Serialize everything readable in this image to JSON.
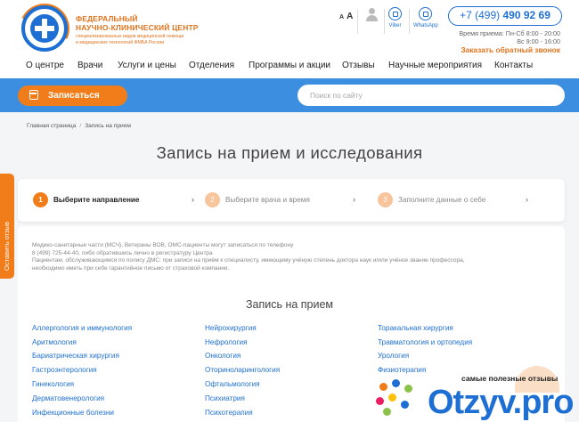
{
  "header": {
    "title_line1": "ФЕДЕРАЛЬНЫЙ",
    "title_line2": "НАУЧНО-КЛИНИЧЕСКИЙ ЦЕНТР",
    "subtitle_line1": "специализированных видов медицинской помощи",
    "subtitle_line2": "и медицинских технологий ФМБА России",
    "font_small": "A",
    "font_large": "A",
    "viber_label": "Viber",
    "whatsapp_label": "WhatsApp",
    "phone_prefix": "+7 (499) ",
    "phone_number": "490 92 69",
    "hours_line1": "Время приема: Пн-Сб 8:00 - 20:00",
    "hours_line2": "Вс 9:00 - 16:00",
    "callback_label": "Заказать обратный звонок"
  },
  "nav": {
    "items": [
      "О центре",
      "Врачи",
      "Услуги и цены",
      "Отделения",
      "Программы и акции",
      "Отзывы",
      "Научные мероприятия",
      "Контакты"
    ]
  },
  "bar": {
    "signup_label": "Записаться",
    "search_placeholder": "Поиск по сайту"
  },
  "breadcrumb": {
    "home": "Главная страница",
    "separator": "/",
    "current": "Запись на прием"
  },
  "page_title": "Запись на прием и исследования",
  "side_tab": "Оставить отзыв",
  "steps": [
    {
      "num": "1",
      "label": "Выберите направление",
      "state": "active"
    },
    {
      "num": "2",
      "label": "Выберите врача и время",
      "state": "inactive"
    },
    {
      "num": "3",
      "label": "Заполните данные о себе",
      "state": "inactive"
    }
  ],
  "step_arrow": "›",
  "notice": {
    "line1": "Медико-санитарные части (МСЧ), Ветераны ВОВ, ОМС-пациенты могут записаться по телефону",
    "line2": "8 (499) 725-44-40, либо обратившись лично в регистратуру Центра",
    "line3": "Пациентам, обслуживающимся по полису ДМС: при записи на приём к специалисту, имеющему учёную степень доктора наук и/или учёное звание профессора,",
    "line4": "необходимо иметь при себе гарантийное письмо от страховой компании."
  },
  "section_title": "Запись на прием",
  "specialties": {
    "col1": [
      "Аллергология и иммунология",
      "Аритмология",
      "Бариатрическая хирургия",
      "Гастроэнтерология",
      "Гинекология",
      "Дерматовенерология",
      "Инфекционные болезни"
    ],
    "col2": [
      "Нейрохирургия",
      "Нефрология",
      "Онкология",
      "Оториноларингология",
      "Офтальмология",
      "Психиатрия",
      "Психотерапия"
    ],
    "col3": [
      "Торакальная хирургия",
      "Травматология и ортопедия",
      "Урология",
      "Физиотерапия"
    ]
  },
  "watermark": {
    "tagline": "самые полезные отзывы",
    "logo": "Otzyv.pro"
  },
  "colors": {
    "brand_blue": "#1e6fd3",
    "bar_blue": "#3c8fe0",
    "accent_orange": "#f07d1a"
  }
}
